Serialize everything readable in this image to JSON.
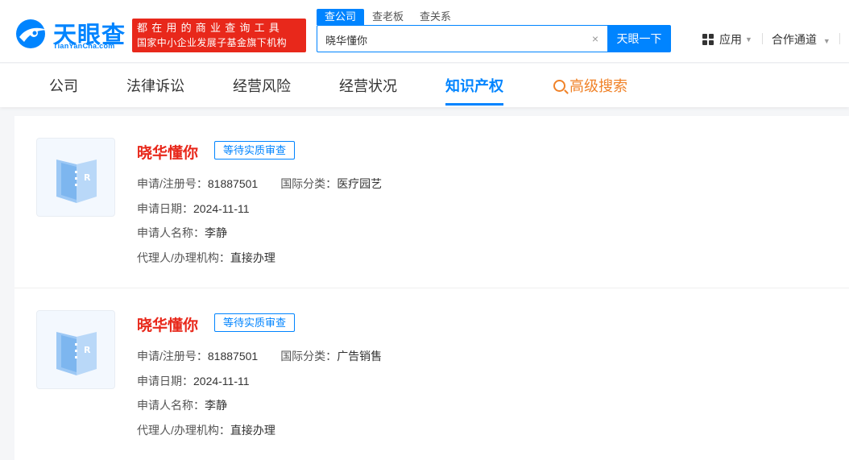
{
  "header": {
    "logo_cn": "天眼查",
    "logo_en": "TianYanCha.com",
    "slogan_line1": "都在用的商业查询工具",
    "slogan_line2": "国家中小企业发展子基金旗下机构",
    "search_tabs": [
      "查公司",
      "查老板",
      "查关系"
    ],
    "search_value": "晓华懂你",
    "search_clear": "×",
    "search_button": "天眼一下",
    "nav_apps": "应用",
    "nav_coop": "合作通道"
  },
  "categories": [
    "公司",
    "法律诉讼",
    "经营风险",
    "经营状况",
    "知识产权",
    "高级搜索"
  ],
  "active_category": "知识产权",
  "labels": {
    "reg_no": "申请/注册号：",
    "intl_class": "国际分类：",
    "apply_date": "申请日期：",
    "applicant": "申请人名称：",
    "agent": "代理人/办理机构："
  },
  "results": [
    {
      "name": "晓华懂你",
      "status": "等待实质审查",
      "reg_no": "81887501",
      "intl_class": "医疗园艺",
      "apply_date": "2024-11-11",
      "applicant": "李静",
      "agent": "直接办理"
    },
    {
      "name": "晓华懂你",
      "status": "等待实质审查",
      "reg_no": "81887501",
      "intl_class": "广告销售",
      "apply_date": "2024-11-11",
      "applicant": "李静",
      "agent": "直接办理"
    }
  ],
  "colors": {
    "brand_blue": "#0084ff",
    "title_red": "#e8281b",
    "advanced_orange": "#f08228"
  }
}
